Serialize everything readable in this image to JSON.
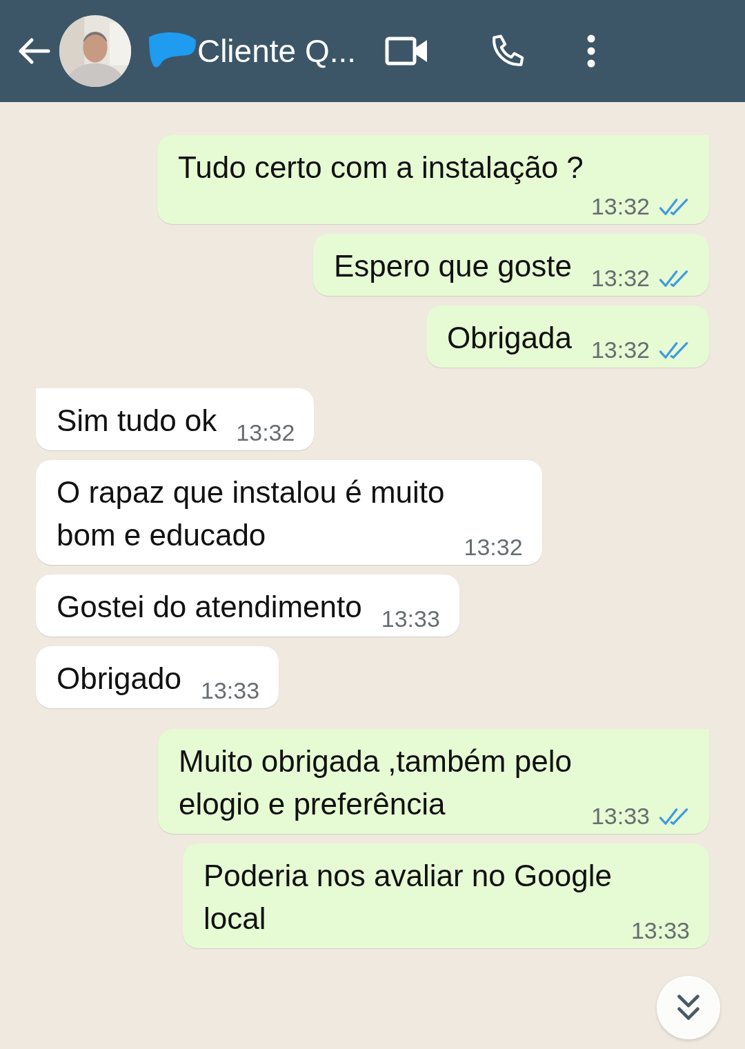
{
  "header": {
    "title": "Cliente Q..."
  },
  "messages": [
    {
      "kind": "out",
      "tail": true,
      "lines": [
        "Tudo certo com a instalação ?"
      ],
      "time": "13:32",
      "read": true
    },
    {
      "kind": "out",
      "tail": false,
      "lines": [
        "Espero que goste"
      ],
      "time": "13:32",
      "read": true
    },
    {
      "kind": "out",
      "tail": false,
      "lines": [
        "Obrigada"
      ],
      "time": "13:32",
      "read": true
    },
    {
      "kind": "in",
      "tail": true,
      "lines": [
        "Sim tudo ok"
      ],
      "time": "13:32"
    },
    {
      "kind": "in",
      "tail": false,
      "lines": [
        "O rapaz que instalou é muito",
        "bom e educado"
      ],
      "time": "13:32"
    },
    {
      "kind": "in",
      "tail": false,
      "lines": [
        "Gostei do atendimento"
      ],
      "time": "13:33"
    },
    {
      "kind": "in",
      "tail": false,
      "lines": [
        "Obrigado"
      ],
      "time": "13:33"
    },
    {
      "kind": "out",
      "tail": true,
      "lines": [
        "Muito obrigada ,também pelo",
        "elogio e preferência"
      ],
      "time": "13:33",
      "read": true
    },
    {
      "kind": "out",
      "tail": false,
      "lines": [
        "Poderia nos avaliar no Google",
        "local"
      ],
      "time": "13:33"
    }
  ]
}
